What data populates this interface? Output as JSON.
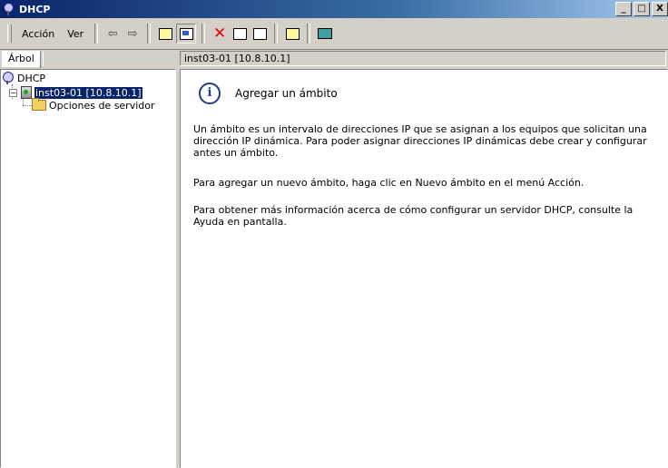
{
  "window": {
    "title": "DHCP",
    "buttons": [
      "_",
      "□",
      "X"
    ]
  },
  "menu": {
    "accion": "Acción",
    "ver": "Ver"
  },
  "toolbar": {
    "icons": [
      "back-arrow-icon",
      "forward-arrow-icon",
      "up-folder-icon",
      "show-tree-icon",
      "delete-icon",
      "properties-icon",
      "refresh-icon",
      "help-icon",
      "console-icon"
    ]
  },
  "tabs": {
    "tree_tab": "Árbol"
  },
  "content_header": "inst03-01 [10.8.10.1]",
  "tree": {
    "root": "DHCP",
    "server": "inst03-01 [10.8.10.1]",
    "server_options": "Opciones de servidor"
  },
  "content": {
    "heading": "Agregar un ámbito",
    "paragraph1": "Un ámbito es un intervalo de direcciones IP que se asignan a los equipos que solicitan una dirección IP dinámica. Para poder asignar direcciones IP dinámicas debe crear y configurar antes un ámbito.",
    "paragraph2": "Para agregar un nuevo ámbito, haga clic en Nuevo ámbito en el menú Acción.",
    "paragraph3": "Para obtener más información acerca de cómo configurar un servidor DHCP, consulte la Ayuda en pantalla."
  },
  "colors": {
    "titlebar_start": "#0a246a",
    "titlebar_end": "#a6caf0",
    "selection": "#0a246a",
    "window_bg": "#d4d0c8"
  }
}
